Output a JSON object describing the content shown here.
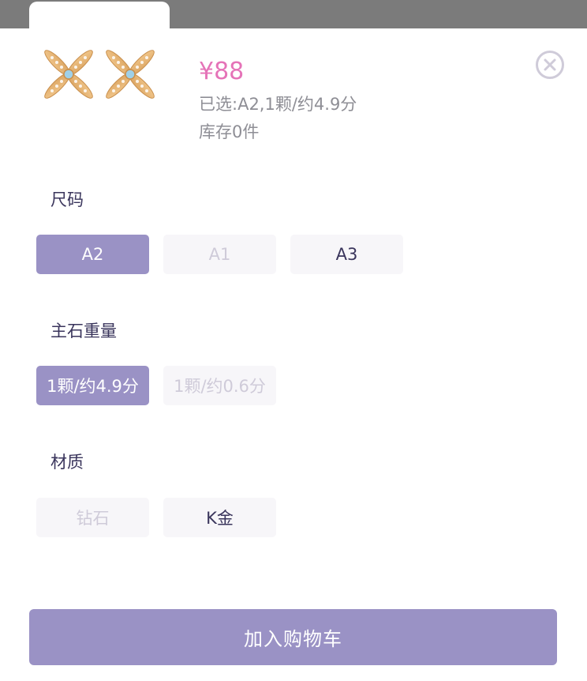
{
  "product": {
    "price": "¥88",
    "selected_text": "已选:A2,1颗/约4.9分",
    "stock_text": "库存0件",
    "image_icon": "earring-cross-icon"
  },
  "sections": {
    "size": {
      "title": "尺码",
      "options": [
        {
          "label": "A2",
          "state": "selected"
        },
        {
          "label": "A1",
          "state": "disabled"
        },
        {
          "label": "A3",
          "state": "available"
        }
      ]
    },
    "stone_weight": {
      "title": "主石重量",
      "options": [
        {
          "label": "1颗/约4.9分",
          "state": "selected"
        },
        {
          "label": "1颗/约0.6分",
          "state": "disabled"
        }
      ]
    },
    "material": {
      "title": "材质",
      "options": [
        {
          "label": "钻石",
          "state": "disabled"
        },
        {
          "label": "K金",
          "state": "available"
        }
      ]
    }
  },
  "actions": {
    "add_to_cart_label": "加入购物车",
    "close_icon": "close-circle-icon"
  },
  "colors": {
    "accent": "#9a92c5",
    "price": "#e573b8",
    "text_primary": "#3a355c",
    "text_secondary": "#8e8e95",
    "disabled_text": "#cfcbd9",
    "option_bg": "#f7f6f9"
  }
}
